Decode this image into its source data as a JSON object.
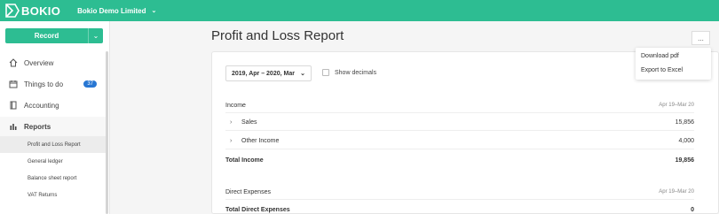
{
  "topbar": {
    "logo_text": "BOKIO",
    "company": "Bokio Demo Limited"
  },
  "sidebar": {
    "record_label": "Record",
    "items": [
      {
        "label": "Overview",
        "icon": "home-icon"
      },
      {
        "label": "Things to do",
        "icon": "calendar-icon",
        "badge": "37"
      },
      {
        "label": "Accounting",
        "icon": "book-icon"
      },
      {
        "label": "Reports",
        "icon": "bar-chart-icon"
      }
    ],
    "sub_items": [
      {
        "label": "Profit and Loss Report"
      },
      {
        "label": "General ledger"
      },
      {
        "label": "Balance sheet report"
      },
      {
        "label": "VAT Returns"
      }
    ]
  },
  "page": {
    "title": "Profit and Loss Report",
    "more_label": "...",
    "period": "2019, Apr – 2020, Mar",
    "show_decimals": "Show decimals"
  },
  "menu": {
    "items": [
      "Download pdf",
      "Export to Excel"
    ]
  },
  "report": {
    "income": {
      "label": "Income",
      "period": "Apr 19–Mar 20"
    },
    "sales": {
      "label": "Sales",
      "value": "15,856"
    },
    "other_income": {
      "label": "Other Income",
      "value": "4,000"
    },
    "total_income": {
      "label": "Total Income",
      "value": "19,856"
    },
    "direct_expenses": {
      "label": "Direct Expenses",
      "period": "Apr 19–Mar 20"
    },
    "total_direct_expenses": {
      "label": "Total Direct Expenses",
      "value": "0"
    }
  },
  "colors": {
    "brand": "#2dbd92",
    "badge": "#2877d3"
  }
}
